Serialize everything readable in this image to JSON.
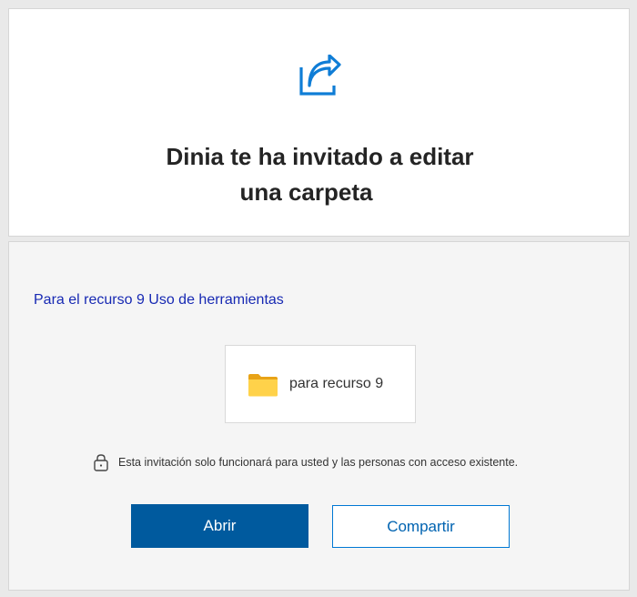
{
  "header": {
    "icon": "share-arrow-icon",
    "title_line1": "Dinia te ha invitado a editar",
    "title_line2": "una carpeta"
  },
  "message": "Para el recurso 9 Uso de herramientas",
  "folder": {
    "icon": "folder-icon",
    "name": "para recurso 9"
  },
  "notice": {
    "icon": "lock-icon",
    "text": "Esta invitación solo funcionará para usted y las personas con acceso existente."
  },
  "buttons": {
    "open_label": "Abrir",
    "share_label": "Compartir"
  },
  "colors": {
    "accent": "#0078d4",
    "primary_button": "#005a9e",
    "link_text": "#1729b3",
    "folder_yellow": "#f7c948"
  }
}
